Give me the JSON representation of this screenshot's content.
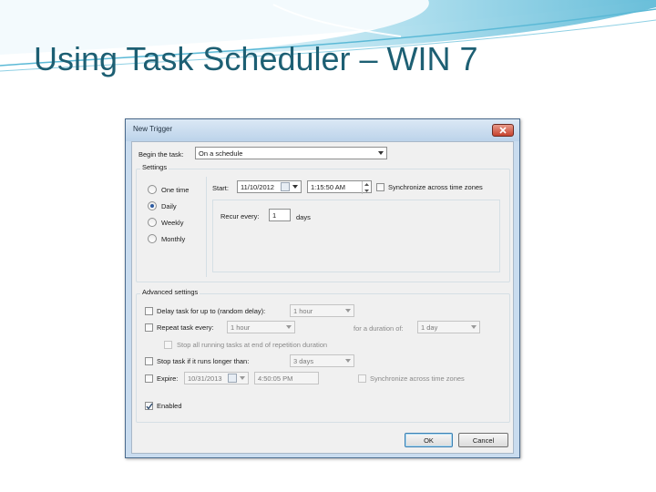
{
  "slide": {
    "title": "Using Task Scheduler – WIN 7"
  },
  "dialog": {
    "title": "New Trigger",
    "begin_task_label": "Begin the task:",
    "begin_task_value": "On a schedule",
    "settings": {
      "group_label": "Settings",
      "radios": [
        {
          "label": "One time",
          "selected": false
        },
        {
          "label": "Daily",
          "selected": true
        },
        {
          "label": "Weekly",
          "selected": false
        },
        {
          "label": "Monthly",
          "selected": false
        }
      ],
      "start_label": "Start:",
      "start_date": "11/10/2012",
      "start_time": "1:15:50 AM",
      "sync_label": "Synchronize across time zones",
      "recur_label": "Recur every:",
      "recur_value": "1",
      "recur_unit": "days"
    },
    "advanced": {
      "group_label": "Advanced settings",
      "delay_label": "Delay task for up to (random delay):",
      "delay_value": "1 hour",
      "repeat_label": "Repeat task every:",
      "repeat_value": "1 hour",
      "duration_label": "for a duration of:",
      "duration_value": "1 day",
      "stop_all_label": "Stop all running tasks at end of repetition duration",
      "stop_if_label": "Stop task if it runs longer than:",
      "stop_if_value": "3 days",
      "expire_label": "Expire:",
      "expire_date": "10/31/2013",
      "expire_time": "4:50:05 PM",
      "expire_sync_label": "Synchronize across time zones",
      "enabled_label": "Enabled",
      "enabled_checked": true
    },
    "ok_label": "OK",
    "cancel_label": "Cancel"
  },
  "colors": {
    "title": "#1d5f73",
    "dialog_frame": "#c9dcef",
    "accent_swoosh": "#5bb9d6"
  }
}
